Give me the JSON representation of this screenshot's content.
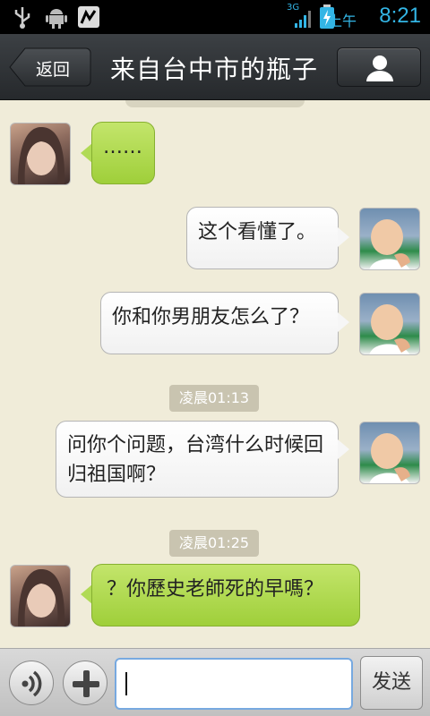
{
  "status_bar": {
    "network": "3G",
    "ampm": "上午",
    "time": "8:21"
  },
  "header": {
    "back_label": "返回",
    "title": "来自台中市的瓶子",
    "profile_icon": "person-icon"
  },
  "messages": [
    {
      "side": "left",
      "sender": "peer",
      "text": "……"
    },
    {
      "side": "right",
      "sender": "me",
      "text": "这个看懂了。"
    },
    {
      "side": "right",
      "sender": "me",
      "text": "你和你男朋友怎么了？"
    },
    {
      "timestamp": "凌晨01:13"
    },
    {
      "side": "right",
      "sender": "me",
      "text": "问你个问题，台湾什么时候回归祖国啊？"
    },
    {
      "timestamp": "凌晨01:25"
    },
    {
      "side": "left",
      "sender": "peer",
      "text": "？你歷史老師死的早嗎？"
    }
  ],
  "input_bar": {
    "voice_icon": "voice-icon",
    "plus_icon": "plus-icon",
    "input_value": "",
    "send_label": "发送"
  },
  "colors": {
    "background": "#f0ecd9",
    "peer_bubble": "#aed651",
    "own_bubble": "#ffffff",
    "accent": "#33b5e5"
  }
}
